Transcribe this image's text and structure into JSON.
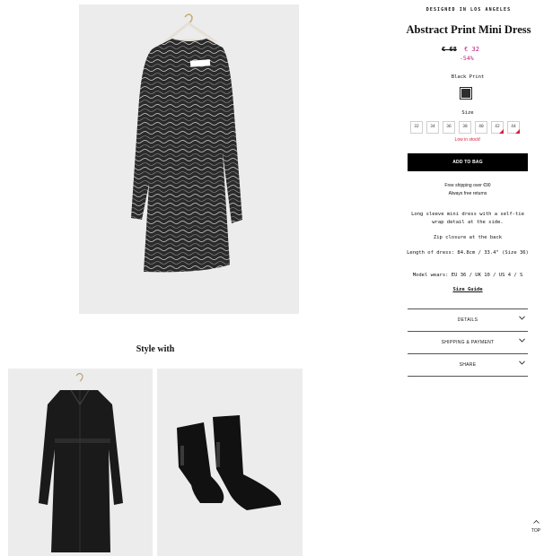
{
  "product": {
    "brandline": "DESIGNED IN LOS ANGELES",
    "title": "Abstract Print Mini Dress",
    "old_price": "€ 68",
    "new_price": "€ 32",
    "discount": "-54%",
    "color_label": "Black Print",
    "size_label": "Size",
    "sizes": [
      "32",
      "34",
      "36",
      "38",
      "40",
      "42",
      "44"
    ],
    "low_stock_sizes": [
      "42",
      "44"
    ],
    "low_stock_text": "Low in stock!",
    "add_to_bag": "ADD TO BAG",
    "shipping_line1": "Free shipping over €90",
    "shipping_line2": "Always free returns",
    "description": [
      "Long sleeve mini dress with a self-tie wrap detail at the side.",
      "Zip closure at the back",
      "Length of dress: 84.8cm / 33.4\" (Size 36)",
      "Model wears: EU 36 / UK 10 / US 4 / S"
    ],
    "size_guide": "Size Guide"
  },
  "style_with": {
    "heading": "Style with"
  },
  "accordion": {
    "details": "DETAILS",
    "shipping": "SHIPPING & PAYMENT",
    "share": "SHARE"
  },
  "back_to_top": "TOP"
}
